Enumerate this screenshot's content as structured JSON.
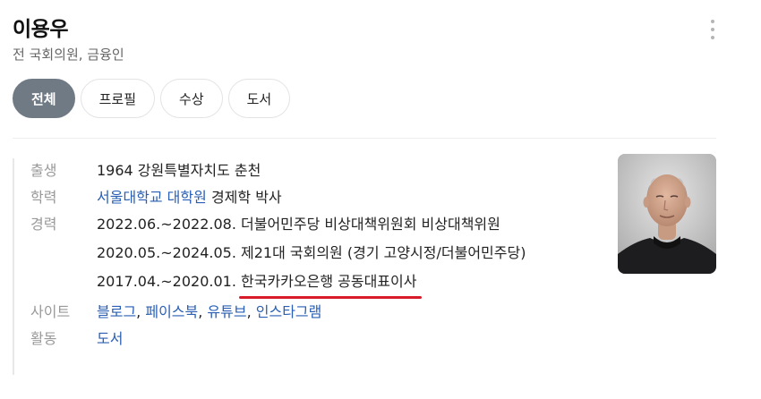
{
  "profile": {
    "name": "이용우",
    "subtitle": "전 국회의원, 금융인"
  },
  "tabs": [
    {
      "label": "전체",
      "active": true
    },
    {
      "label": "프로필",
      "active": false
    },
    {
      "label": "수상",
      "active": false
    },
    {
      "label": "도서",
      "active": false
    }
  ],
  "info": {
    "birth": {
      "label": "출생",
      "value": "1964 강원특별자치도 춘천"
    },
    "education": {
      "label": "학력",
      "school": "서울대학교 대학원",
      "detail": "경제학 박사"
    },
    "career": {
      "label": "경력",
      "items": [
        {
          "period": "2022.06.~2022.08.",
          "role": "더불어민주당 비상대책위원회 비상대책위원"
        },
        {
          "period": "2020.05.~2024.05.",
          "role": "제21대 국회의원 (경기 고양시정/더불어민주당)"
        },
        {
          "period": "2017.04.~2020.01.",
          "role": "한국카카오은행 공동대표이사"
        }
      ]
    },
    "sites": {
      "label": "사이트",
      "links": [
        "블로그",
        "페이스북",
        "유튜브",
        "인스타그램"
      ],
      "separator": ", "
    },
    "activity": {
      "label": "활동",
      "value": "도서"
    }
  },
  "colors": {
    "link": "#2a5fb3",
    "active_tab": "#6f7a85",
    "highlight_underline": "#d81b2b"
  }
}
